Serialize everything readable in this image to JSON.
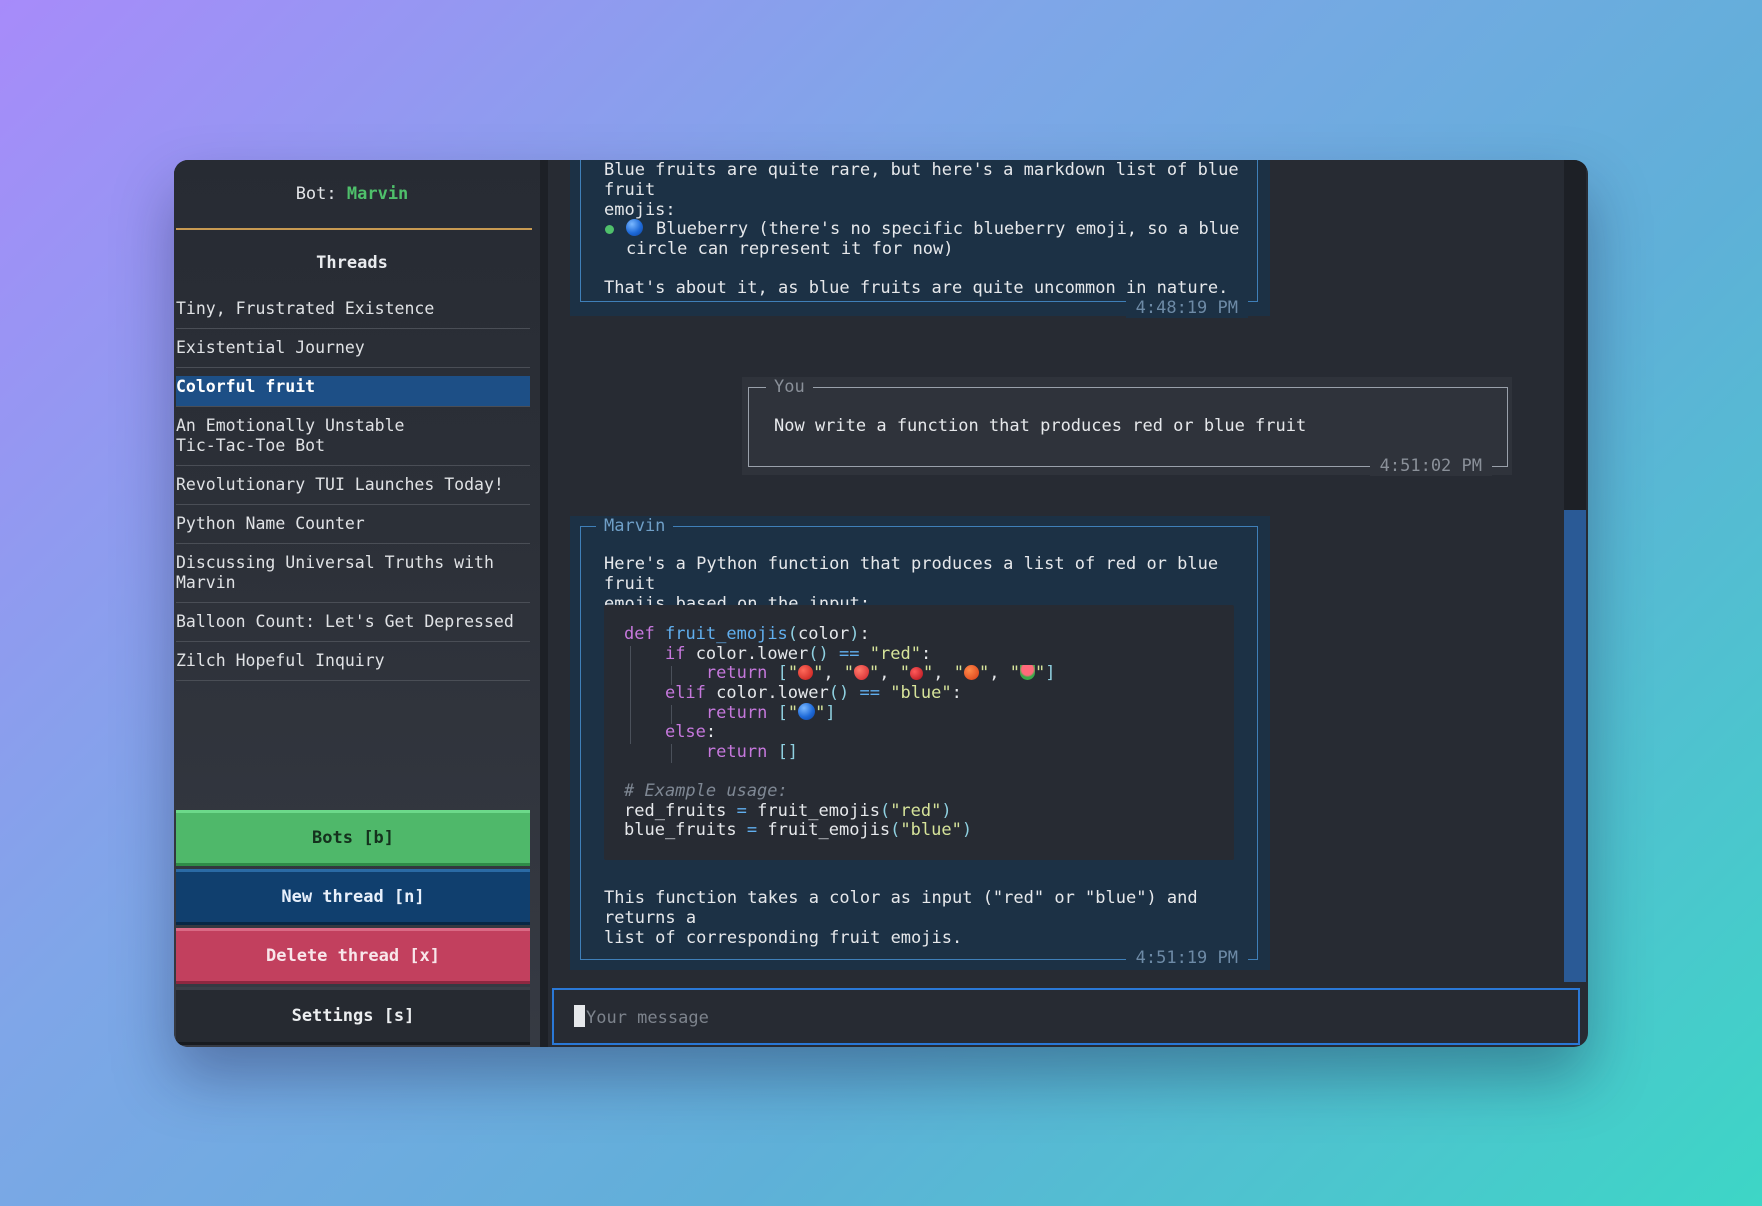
{
  "sidebar": {
    "bot_prefix": "Bot: ",
    "bot_name": "Marvin",
    "threads_title": "Threads",
    "threads": [
      {
        "label": "Tiny, Frustrated Existence"
      },
      {
        "label": "Existential Journey"
      },
      {
        "label": "Colorful fruit",
        "active": true
      },
      {
        "label": "An Emotionally Unstable\nTic-Tac-Toe Bot"
      },
      {
        "label": "Revolutionary TUI Launches Today!"
      },
      {
        "label": "Python Name Counter"
      },
      {
        "label": "Discussing Universal Truths with\nMarvin"
      },
      {
        "label": "Balloon Count: Let's Get Depressed"
      },
      {
        "label": "Zilch Hopeful Inquiry"
      }
    ],
    "buttons": {
      "bots": "Bots [b]",
      "new_thread": "New thread [n]",
      "delete_thread": "Delete thread [x]",
      "settings": "Settings [s]"
    }
  },
  "messages": [
    {
      "author": "Marvin",
      "intro": "Blue fruits are quite rare, but here's a markdown list of blue fruit\nemojis:",
      "bullet": "Blueberry (there's no specific blueberry emoji, so a blue\ncircle can represent it for now)",
      "outro": "That's about it, as blue fruits are quite uncommon in nature.",
      "time": "4:48:19 PM"
    },
    {
      "author": "You",
      "text": "Now write a function that produces red or blue fruit",
      "time": "4:51:02 PM"
    },
    {
      "author": "Marvin",
      "intro": "Here's a Python function that produces a list of red or blue fruit\nemojis based on the input:",
      "code": {
        "line1_kw": "def",
        "line1_fn": "fruit_emojis",
        "line1_arg": "color",
        "if_kw": "if",
        "elif_kw": "elif",
        "else_kw": "else",
        "return_kw": "return",
        "lower_call": "color.lower",
        "eq": "==",
        "str_red": "\"red\"",
        "str_blue": "\"blue\"",
        "comment": "# Example usage:",
        "usage1_var": "red_fruits",
        "usage2_var": "blue_fruits"
      },
      "outro": "This function takes a color as input (\"red\" or \"blue\") and returns a\nlist of corresponding fruit emojis.",
      "time": "4:51:19 PM"
    }
  ],
  "input": {
    "placeholder": "Your message"
  },
  "colors": {
    "accent_green": "#4fc06b",
    "accent_blue": "#2a78d6",
    "delete_red": "#c2405e",
    "border_gold": "#c89a52"
  }
}
